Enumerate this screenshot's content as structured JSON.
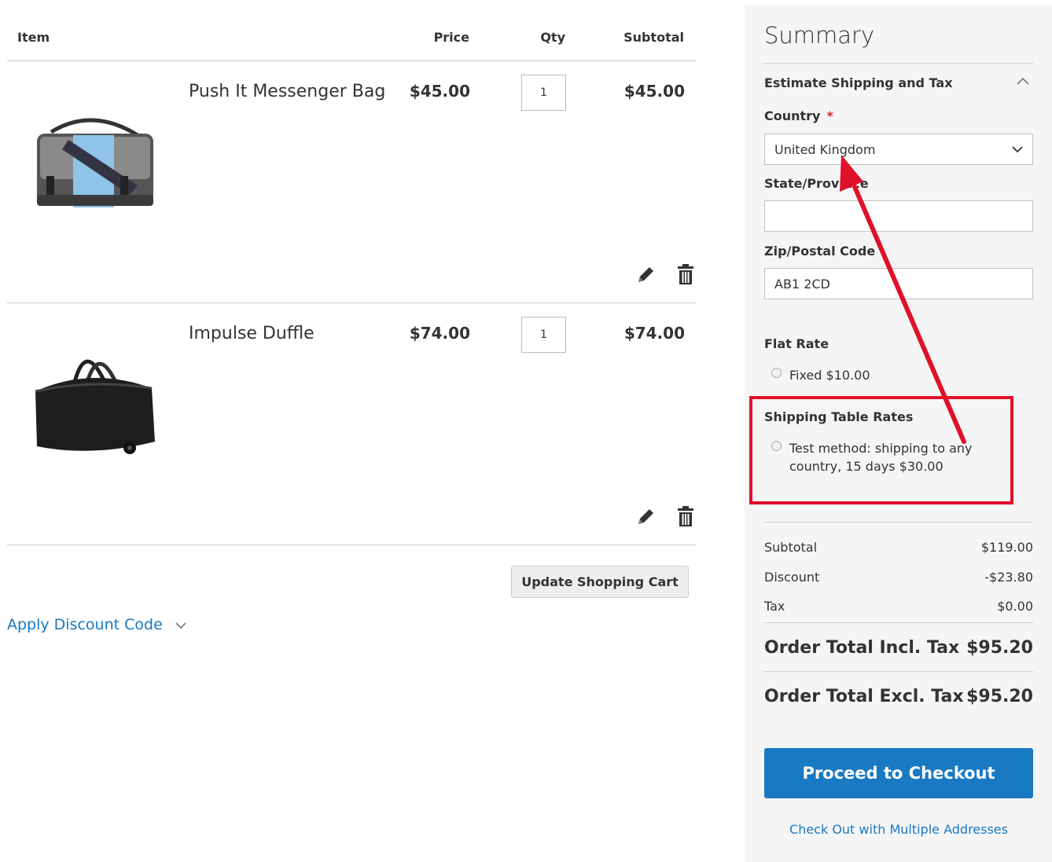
{
  "cart": {
    "headers": {
      "item": "Item",
      "price": "Price",
      "qty": "Qty",
      "subtotal": "Subtotal"
    },
    "items": [
      {
        "name": "Push It Messenger Bag",
        "price": "$45.00",
        "qty": "1",
        "subtotal": "$45.00"
      },
      {
        "name": "Impulse Duffle",
        "price": "$74.00",
        "qty": "1",
        "subtotal": "$74.00"
      }
    ],
    "update_label": "Update Shopping Cart",
    "discount_label": "Apply Discount Code"
  },
  "summary": {
    "title": "Summary",
    "estimate": {
      "title": "Estimate Shipping and Tax",
      "country_label": "Country",
      "required_mark": "*",
      "country_value": "United Kingdom",
      "state_label": "State/Province",
      "state_value": "",
      "zip_label": "Zip/Postal Code",
      "zip_value": "AB1 2CD"
    },
    "shipping": {
      "flat_rate_title": "Flat Rate",
      "flat_rate_option": "Fixed $10.00",
      "table_rates_title": "Shipping Table Rates",
      "table_rates_option": "Test method: shipping to any country, 15 days $30.00"
    },
    "totals": {
      "subtotal_label": "Subtotal",
      "subtotal_value": "$119.00",
      "discount_label": "Discount",
      "discount_value": "-$23.80",
      "tax_label": "Tax",
      "tax_value": "$0.00",
      "incl_label": "Order Total Incl. Tax",
      "incl_value": "$95.20",
      "excl_label": "Order Total Excl. Tax",
      "excl_value": "$95.20"
    },
    "checkout_label": "Proceed to Checkout",
    "multi_label": "Check Out with Multiple Addresses"
  },
  "colors": {
    "accent": "#1979c3",
    "annotation": "#e0102a",
    "summary_bg": "#f5f5f5"
  },
  "icons": [
    "pencil-icon",
    "trash-icon",
    "chevron-down-icon",
    "chevron-up-icon",
    "messenger-bag-image",
    "duffle-bag-image"
  ]
}
